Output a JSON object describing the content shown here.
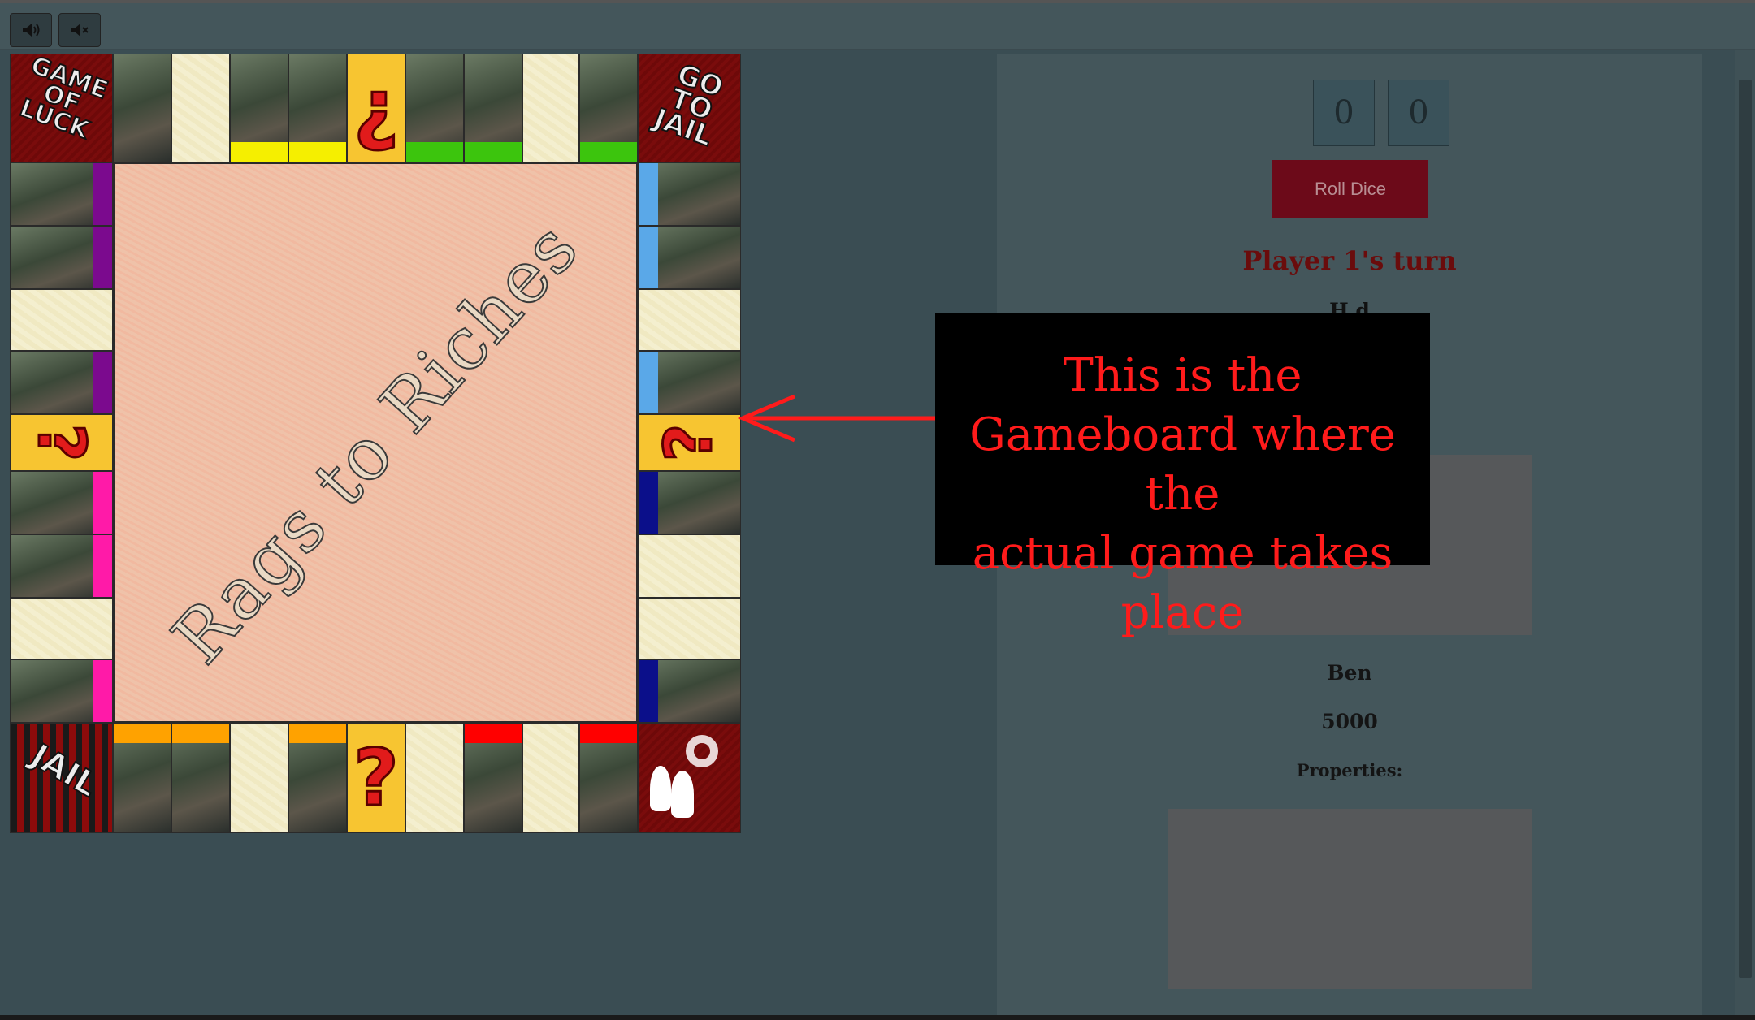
{
  "sound": {
    "on_icon": "speaker-on-icon",
    "off_icon": "speaker-muted-icon"
  },
  "board": {
    "title": "Rags to Riches",
    "corners": {
      "top_left": "GAME OF LUCK",
      "top_right": "GO TO JAIL",
      "bottom_left": "JAIL"
    },
    "question_mark": "?",
    "inverted_question_mark": "¿",
    "colors": {
      "yellow": "#f5ef00",
      "green": "#3cc50d",
      "purple": "#7b0a8e",
      "pink": "#ff1aa8",
      "light_blue": "#5aa8e8",
      "dark_blue": "#0b0f8a",
      "orange": "#ffa200",
      "red": "#ff0000"
    }
  },
  "dice": [
    "0",
    "0"
  ],
  "roll_button": "Roll Dice",
  "turn_text": "Player 1's turn",
  "partial_label": "H      d",
  "player": {
    "name": "Ben",
    "money": "5000",
    "properties_label": "Properties:"
  },
  "annotation": {
    "line1": "This is the",
    "line2": "Gameboard where the",
    "line3": "actual game takes place"
  }
}
